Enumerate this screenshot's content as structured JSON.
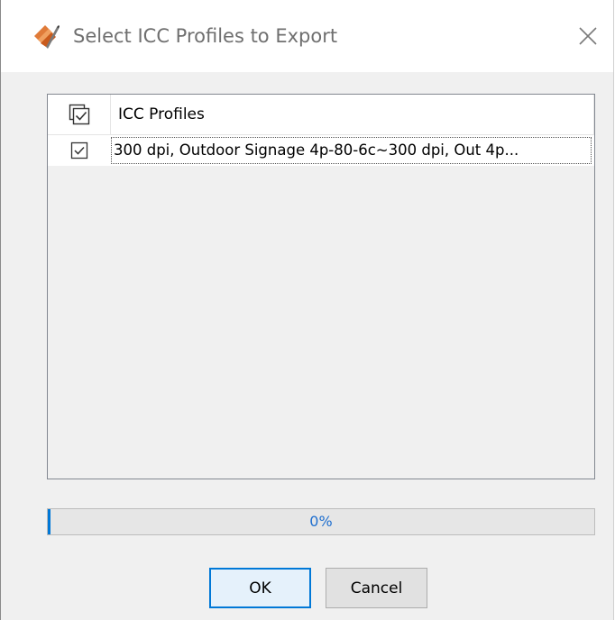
{
  "window": {
    "title": "Select ICC Profiles to Export",
    "icon": "color-swatch-pen-icon",
    "close_icon": "close-icon"
  },
  "table": {
    "header": {
      "select_all_icon": "stacked-checkbox-icon",
      "column_label": "ICC Profiles"
    },
    "rows": [
      {
        "checked": true,
        "label": "300 dpi, Outdoor Signage 4p-80-6c~300 dpi, Out 4p..."
      }
    ]
  },
  "progress": {
    "value_percent": 0,
    "label": "0%"
  },
  "buttons": {
    "ok_label": "OK",
    "cancel_label": "Cancel"
  },
  "colors": {
    "accent": "#0078d7",
    "progress_text": "#1f6fcf"
  }
}
